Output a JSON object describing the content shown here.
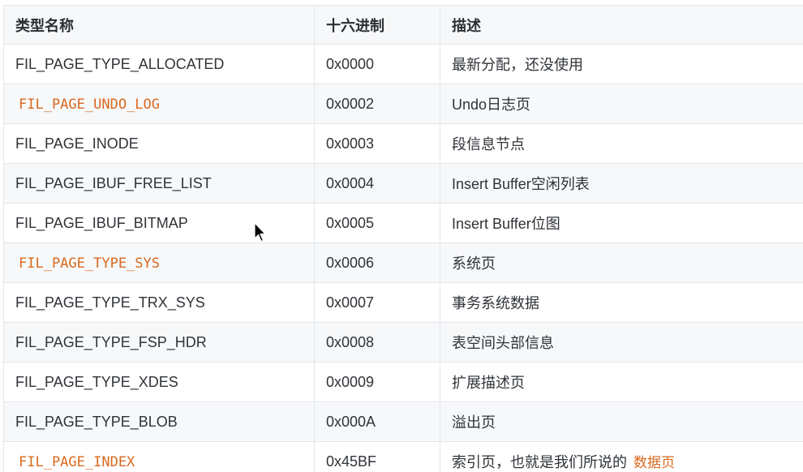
{
  "table": {
    "headers": [
      "类型名称",
      "十六进制",
      "描述"
    ],
    "rows": [
      {
        "name": "FIL_PAGE_TYPE_ALLOCATED",
        "code": false,
        "hex": "0x0000",
        "desc": "最新分配，还没使用"
      },
      {
        "name": "FIL_PAGE_UNDO_LOG",
        "code": true,
        "hex": "0x0002",
        "desc": "Undo日志页"
      },
      {
        "name": "FIL_PAGE_INODE",
        "code": false,
        "hex": "0x0003",
        "desc": "段信息节点"
      },
      {
        "name": "FIL_PAGE_IBUF_FREE_LIST",
        "code": false,
        "hex": "0x0004",
        "desc": "Insert Buffer空闲列表"
      },
      {
        "name": "FIL_PAGE_IBUF_BITMAP",
        "code": false,
        "hex": "0x0005",
        "desc": "Insert Buffer位图"
      },
      {
        "name": "FIL_PAGE_TYPE_SYS",
        "code": true,
        "hex": "0x0006",
        "desc": "系统页"
      },
      {
        "name": "FIL_PAGE_TYPE_TRX_SYS",
        "code": false,
        "hex": "0x0007",
        "desc": "事务系统数据"
      },
      {
        "name": "FIL_PAGE_TYPE_FSP_HDR",
        "code": false,
        "hex": "0x0008",
        "desc": "表空间头部信息"
      },
      {
        "name": "FIL_PAGE_TYPE_XDES",
        "code": false,
        "hex": "0x0009",
        "desc": "扩展描述页"
      },
      {
        "name": "FIL_PAGE_TYPE_BLOB",
        "code": false,
        "hex": "0x000A",
        "desc": "溢出页"
      },
      {
        "name": "FIL_PAGE_INDEX",
        "code": true,
        "hex": "0x45BF",
        "desc": "索引页，也就是我们所说的",
        "desc_highlight": "数据页"
      }
    ]
  },
  "colors": {
    "code_text": "#d9691f",
    "header_bg": "#f6f8fa",
    "border": "#e3e6ea"
  },
  "cursor": {
    "icon": "mouse-pointer-icon"
  }
}
